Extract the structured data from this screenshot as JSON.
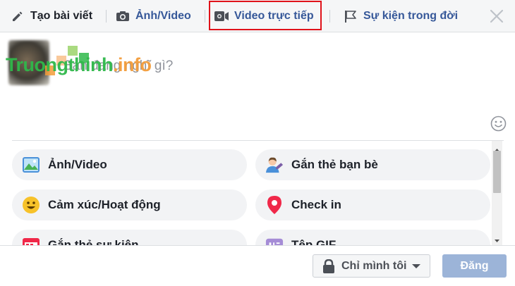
{
  "tabs": [
    {
      "label": "Tạo bài viết",
      "icon": "pencil-icon"
    },
    {
      "label": "Ảnh/Video",
      "icon": "camera-icon"
    },
    {
      "label": "Video trực tiếp",
      "icon": "live-video-icon"
    },
    {
      "label": "Sự kiện trong đời",
      "icon": "flag-icon"
    }
  ],
  "composer": {
    "placeholder": "Bạn đang nghĩ gì?",
    "watermark_main": "Truongthinh",
    "watermark_dot": ".info"
  },
  "options": [
    {
      "label": "Ảnh/Video",
      "icon": "photo-icon"
    },
    {
      "label": "Gắn thẻ bạn bè",
      "icon": "tag-friends-icon"
    },
    {
      "label": "Cảm xúc/Hoạt động",
      "icon": "smiley-icon"
    },
    {
      "label": "Check in",
      "icon": "location-pin-icon"
    },
    {
      "label": "Gắn thẻ sự kiện",
      "icon": "calendar-icon"
    },
    {
      "label": "Tệp GIF",
      "icon": "gif-icon"
    }
  ],
  "footer": {
    "audience_label": "Chỉ mình tôi",
    "post_label": "Đăng"
  },
  "colors": {
    "highlight_border": "#e0121a",
    "link_blue": "#365899",
    "post_button": "#9cb4d8",
    "watermark_green": "#2fb84a",
    "watermark_orange": "#f39c3a"
  }
}
